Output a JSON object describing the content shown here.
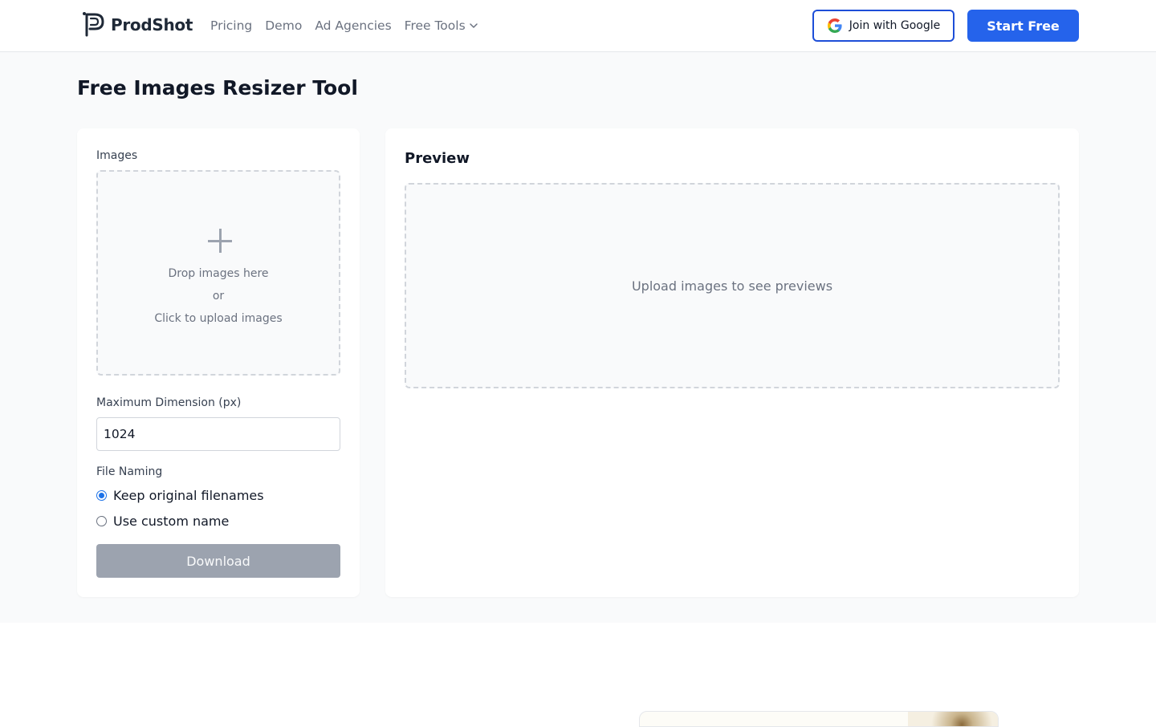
{
  "header": {
    "brand": "ProdShot",
    "nav": [
      {
        "label": "Pricing"
      },
      {
        "label": "Demo"
      },
      {
        "label": "Ad Agencies"
      },
      {
        "label": "Free Tools",
        "has_dropdown": true
      }
    ],
    "join_google_label": "Join with Google",
    "start_free_label": "Start Free",
    "start_free_color": "#2563eb"
  },
  "page": {
    "title": "Free Images Resizer Tool"
  },
  "settings": {
    "images_label": "Images",
    "dropzone": {
      "line1": "Drop images here",
      "line2": "or",
      "line3": "Click to upload images"
    },
    "max_dimension_label": "Maximum Dimension (px)",
    "max_dimension_value": "1024",
    "file_naming_label": "File Naming",
    "naming_options": [
      {
        "label": "Keep original filenames",
        "checked": true
      },
      {
        "label": "Use custom name",
        "checked": false
      }
    ],
    "download_label": "Download",
    "download_enabled": false
  },
  "preview": {
    "title": "Preview",
    "empty_text": "Upload images to see previews"
  }
}
